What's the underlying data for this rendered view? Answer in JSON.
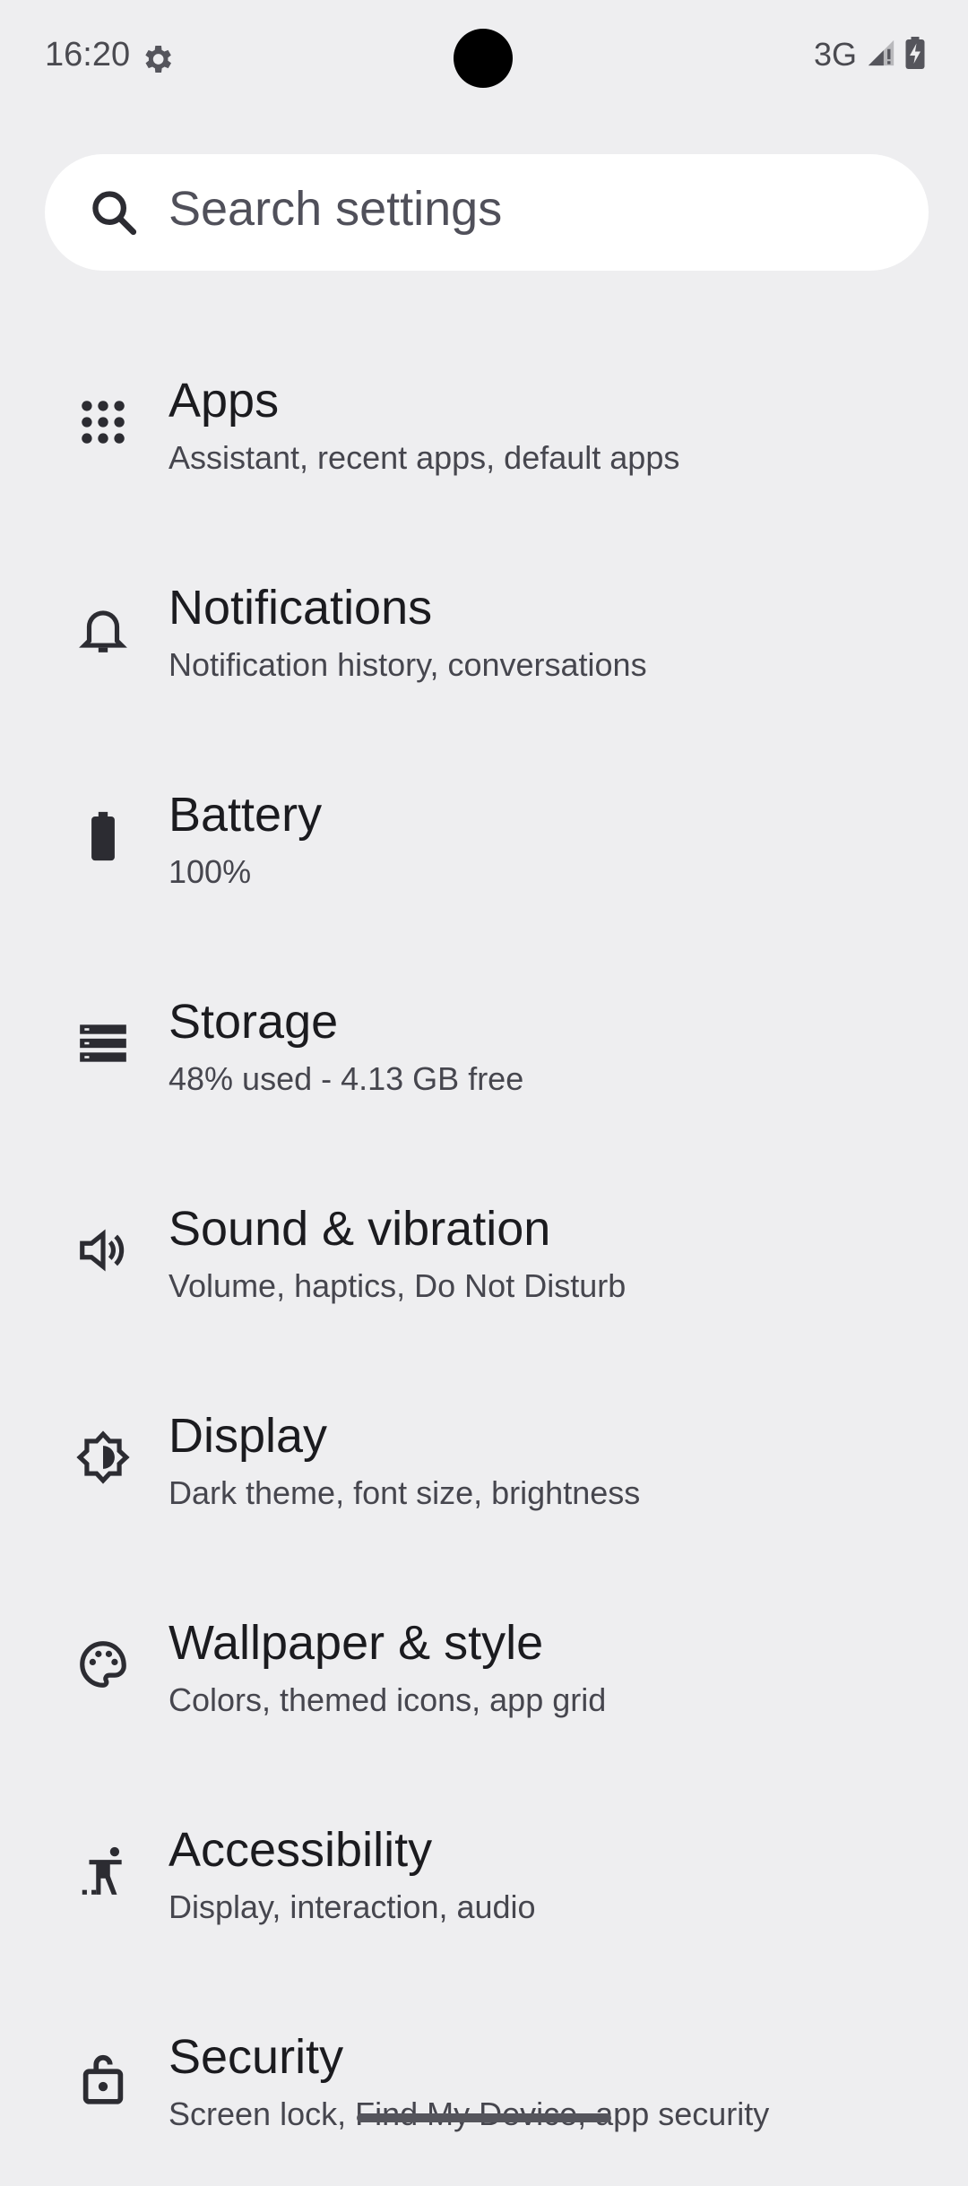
{
  "status_bar": {
    "time": "16:20",
    "network": "3G",
    "icons": [
      "settings-gear-icon",
      "signal-icon",
      "battery-charging-icon"
    ]
  },
  "search": {
    "placeholder": "Search settings"
  },
  "settings_items": [
    {
      "title": "Apps",
      "subtitle": "Assistant, recent apps, default apps",
      "icon": "apps-grid-icon"
    },
    {
      "title": "Notifications",
      "subtitle": "Notification history, conversations",
      "icon": "bell-icon"
    },
    {
      "title": "Battery",
      "subtitle": "100%",
      "icon": "battery-icon"
    },
    {
      "title": "Storage",
      "subtitle": "48% used - 4.13 GB free",
      "icon": "storage-icon"
    },
    {
      "title": "Sound & vibration",
      "subtitle": "Volume, haptics, Do Not Disturb",
      "icon": "speaker-icon"
    },
    {
      "title": "Display",
      "subtitle": "Dark theme, font size, brightness",
      "icon": "brightness-icon"
    },
    {
      "title": "Wallpaper & style",
      "subtitle": "Colors, themed icons, app grid",
      "icon": "palette-icon"
    },
    {
      "title": "Accessibility",
      "subtitle": "Display, interaction, audio",
      "icon": "accessibility-icon"
    },
    {
      "title": "Security",
      "subtitle": "Screen lock, Find My Device, app security",
      "icon": "lock-icon"
    }
  ]
}
